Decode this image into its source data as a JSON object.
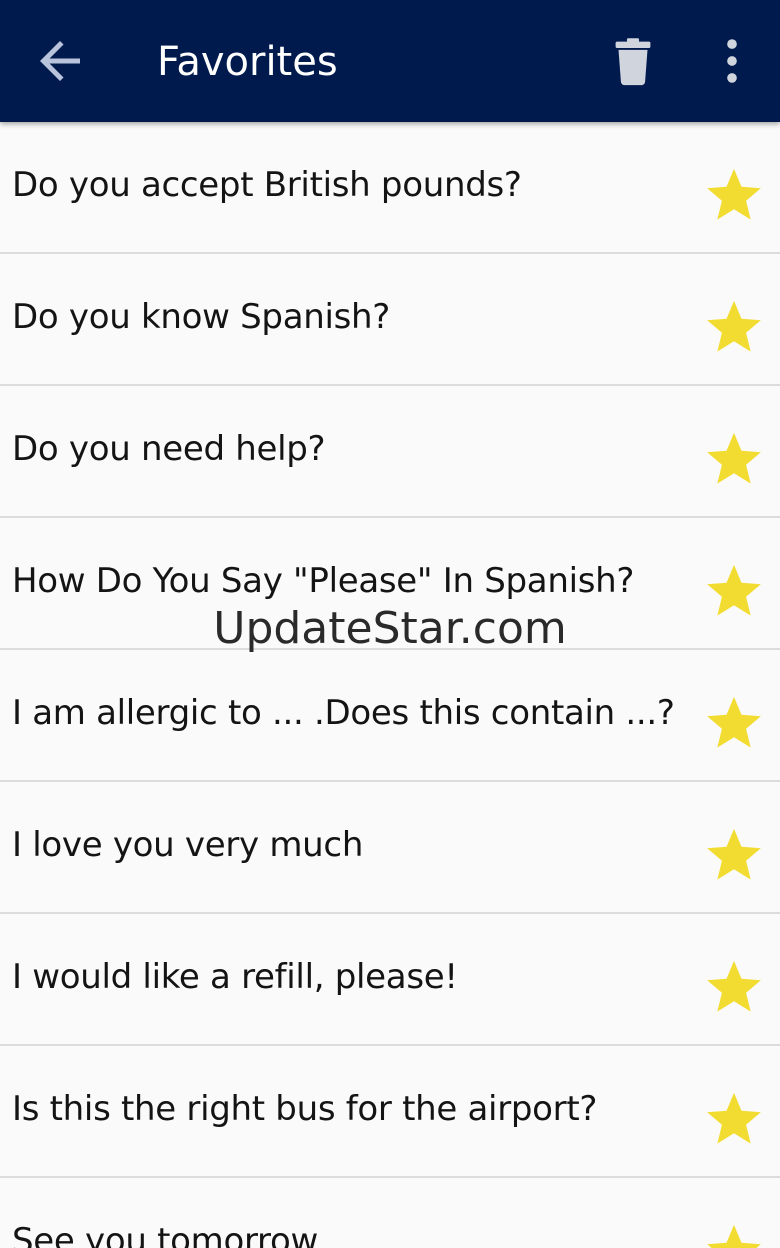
{
  "toolbar": {
    "title": "Favorites",
    "back_icon": "arrow-left-icon",
    "delete_icon": "trash-icon",
    "more_icon": "more-vert-icon",
    "background_color": "#001a4d"
  },
  "favorites": [
    {
      "text": "Do you accept British pounds?",
      "starred": true
    },
    {
      "text": "Do you know Spanish?",
      "starred": true
    },
    {
      "text": "Do you need help?",
      "starred": true
    },
    {
      "text": "How Do You Say \"Please\" In Spanish?",
      "starred": true
    },
    {
      "text": "I am allergic to ... .Does this contain ...?",
      "starred": true
    },
    {
      "text": "I love you very much",
      "starred": true
    },
    {
      "text": "I would like a refill, please!",
      "starred": true
    },
    {
      "text": "Is this the right bus for the airport?",
      "starred": true
    },
    {
      "text": "See you tomorrow",
      "starred": true
    }
  ],
  "star_color": "#f2dc32",
  "watermark": "UpdateStar.com"
}
